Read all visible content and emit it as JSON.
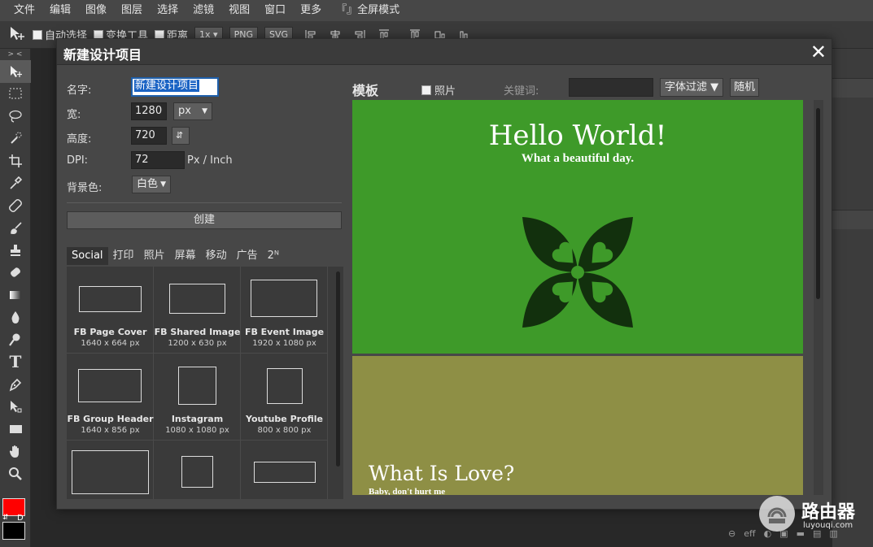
{
  "menu": [
    "文件",
    "编辑",
    "图像",
    "图层",
    "选择",
    "滤镜",
    "视图",
    "窗口",
    "更多",
    "『』全屏模式"
  ],
  "options_bar": {
    "auto_select": "自动选择",
    "transform": "变换工具",
    "distance": "距离",
    "zoom": "1x",
    "png": "PNG",
    "svg": "SVG"
  },
  "toolbar": {
    "collapse": "> <",
    "swap": "⇵",
    "default_colors": "D",
    "foreground_color": "#ff0000",
    "background_color": "#000000",
    "tools": [
      "move-icon",
      "marquee-icon",
      "lasso-icon",
      "quick-select-icon",
      "crop-icon",
      "eyedropper-icon",
      "healing-icon",
      "brush-icon",
      "stamp-icon",
      "eraser-icon",
      "gradient-icon",
      "blur-icon",
      "dodge-icon",
      "text-icon",
      "pen-icon",
      "path-select-icon",
      "rect-shape-icon",
      "hand-icon",
      "zoom-icon"
    ]
  },
  "dialog": {
    "title": "新建设计项目",
    "close": "✕",
    "name_label": "名字:",
    "name_value": "新建设计项目",
    "width_label": "宽:",
    "width_value": "1280",
    "unit": "px",
    "height_label": "高度:",
    "height_value": "720",
    "swap_icon": "⇵",
    "dpi_label": "DPI:",
    "dpi_value": "72",
    "dpi_unit": "Px / Inch",
    "bg_label": "背景色:",
    "bg_value": "白色",
    "create": "创建",
    "tabs": [
      "Social",
      "打印",
      "照片",
      "屏幕",
      "移动",
      "广告",
      "2ᴺ"
    ],
    "active_tab": "Social",
    "presets": [
      {
        "name": "FB Page Cover",
        "size": "1640 x 664 px"
      },
      {
        "name": "FB Shared Image",
        "size": "1200 x 630 px"
      },
      {
        "name": "FB Event Image",
        "size": "1920 x 1080 px"
      },
      {
        "name": "FB Group Header",
        "size": "1640 x 856 px"
      },
      {
        "name": "Instagram",
        "size": "1080 x 1080 px"
      },
      {
        "name": "Youtube Profile",
        "size": "800 x 800 px"
      }
    ],
    "templates_title": "模板",
    "photo_label": "照片",
    "keyword_label": "关键词:",
    "keyword_value": "",
    "font_filter": "字体过滤 ▼",
    "random": "随机",
    "templates": [
      {
        "title": "Hello World!",
        "subtitle": "What a beautiful day.",
        "bg": "#3e9a29"
      },
      {
        "title": "What Is Love?",
        "subtitle": "Baby, don't hurt me",
        "bg": "#8e8f45"
      }
    ]
  },
  "bottom_icons": [
    "link-icon",
    "eff",
    "adjust-icon",
    "mask-icon",
    "folder-icon",
    "new-layer-icon",
    "trash-icon"
  ],
  "watermark": {
    "title": "路由器",
    "sub": "luyouqi.com"
  }
}
